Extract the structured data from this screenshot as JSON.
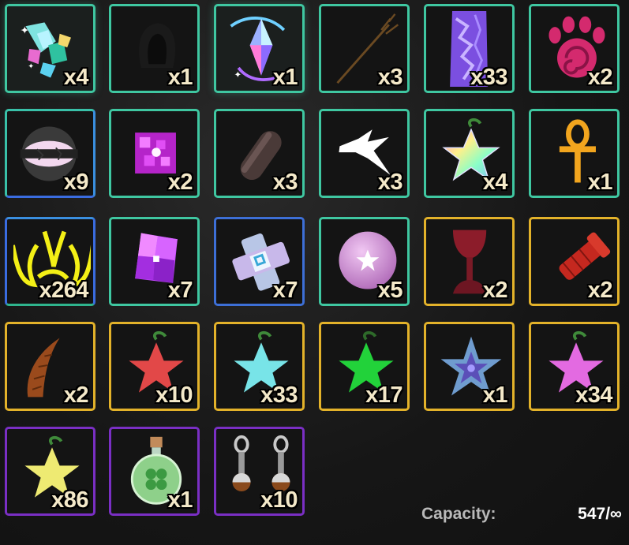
{
  "inventory": {
    "slots": [
      {
        "item_icon": "crystal-shards-icon",
        "count": "x4"
      },
      {
        "item_icon": "dark-hood-icon",
        "count": "x1"
      },
      {
        "item_icon": "prismatic-star-gem-icon",
        "count": "x1"
      },
      {
        "item_icon": "trident-icon",
        "count": "x3"
      },
      {
        "item_icon": "purple-crystal-pillar-icon",
        "count": "x33"
      },
      {
        "item_icon": "pink-paw-swirl-icon",
        "count": "x2"
      },
      {
        "item_icon": "cracked-orb-icon",
        "count": "x9"
      },
      {
        "item_icon": "pink-pixel-cube-icon",
        "count": "x2"
      },
      {
        "item_icon": "stone-capsule-icon",
        "count": "x3"
      },
      {
        "item_icon": "white-fang-icon",
        "count": "x3"
      },
      {
        "item_icon": "rainbow-star-fruit-icon",
        "count": "x4"
      },
      {
        "item_icon": "ankh-icon",
        "count": "x1"
      },
      {
        "item_icon": "yellow-horns-icon",
        "count": "x264"
      },
      {
        "item_icon": "purple-crystal-cube-icon",
        "count": "x7"
      },
      {
        "item_icon": "silver-cross-gem-icon",
        "count": "x7"
      },
      {
        "item_icon": "pink-star-orb-icon",
        "count": "x5"
      },
      {
        "item_icon": "red-goblet-icon",
        "count": "x2"
      },
      {
        "item_icon": "red-gauntlet-icon",
        "count": "x2"
      },
      {
        "item_icon": "curved-horn-icon",
        "count": "x2"
      },
      {
        "item_icon": "red-star-fruit-icon",
        "count": "x10"
      },
      {
        "item_icon": "cyan-star-fruit-icon",
        "count": "x33"
      },
      {
        "item_icon": "green-star-fruit-icon",
        "count": "x17"
      },
      {
        "item_icon": "blue-crystal-flower-icon",
        "count": "x1"
      },
      {
        "item_icon": "pink-star-fruit-icon",
        "count": "x34"
      },
      {
        "item_icon": "yellow-star-fruit-icon",
        "count": "x86"
      },
      {
        "item_icon": "clover-potion-icon",
        "count": "x1"
      },
      {
        "item_icon": "earrings-icon",
        "count": "x10"
      }
    ]
  },
  "footer": {
    "capacity_label": "Capacity:",
    "capacity_value": "547/∞"
  },
  "colors": {
    "teal_border": "#3fc7a1",
    "blue_border": "#3d6fd6",
    "gold_border": "#e3b22a",
    "purple_border": "#7a2fc4",
    "count_text": "#f4e9c9"
  }
}
